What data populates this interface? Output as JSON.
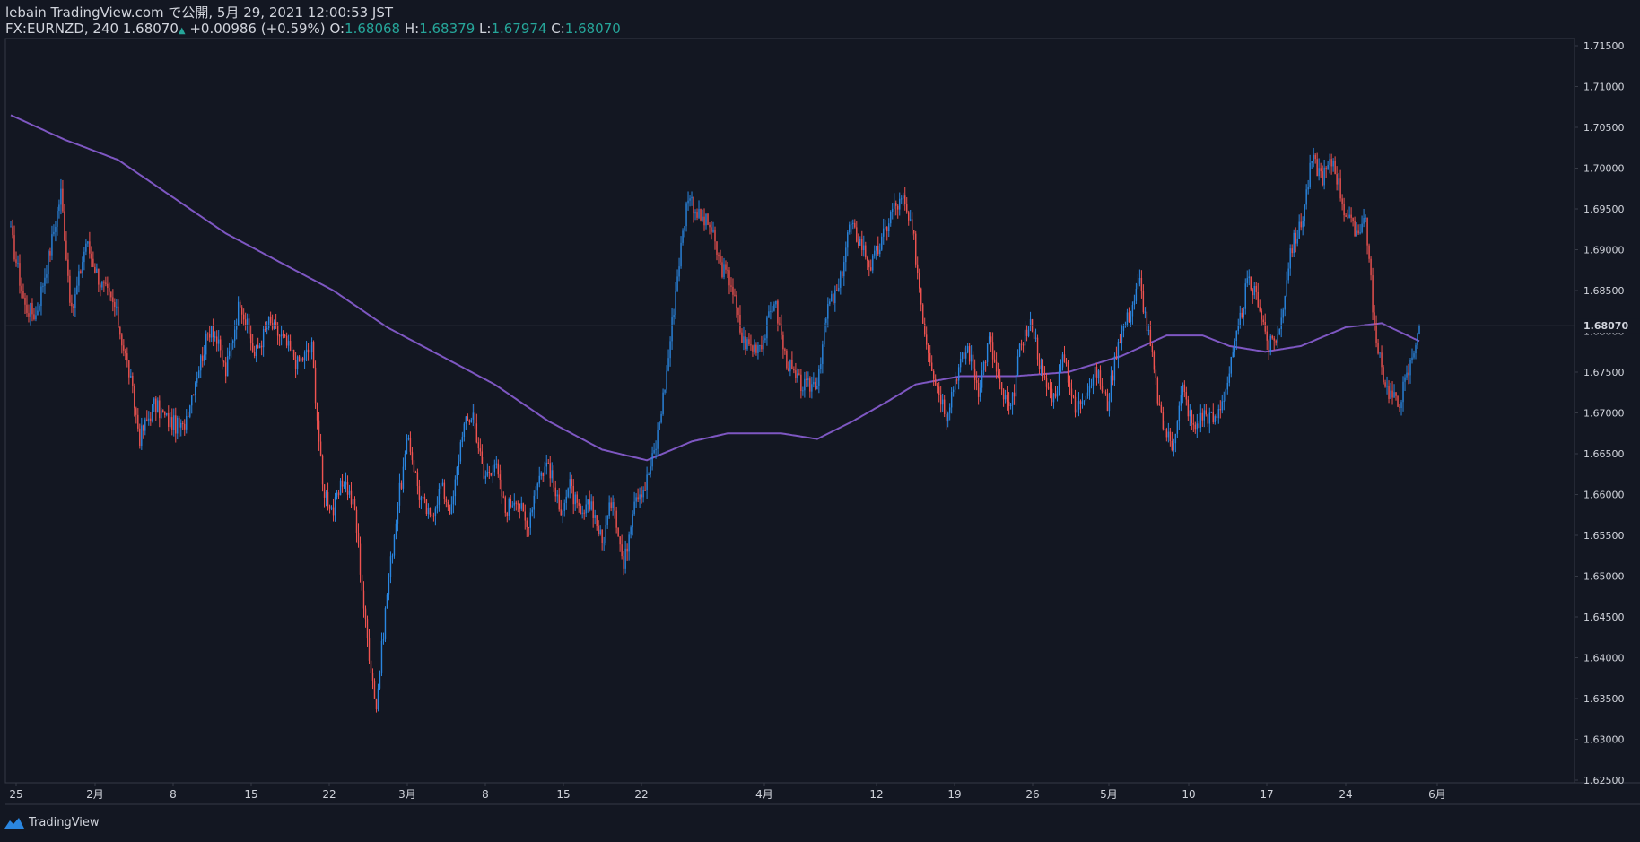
{
  "header": {
    "published": "lebain TradingView.com で公開, 5月 29, 2021 12:00:53 JST",
    "symbol": "FX:EURNZD, 240",
    "last": "1.68070",
    "change": "+0.00986 (+0.59%)",
    "o_label": "O:",
    "o": "1.68068",
    "h_label": "H:",
    "h": "1.68379",
    "l_label": "L:",
    "l": "1.67974",
    "c_label": "C:",
    "c": "1.68070"
  },
  "footer": {
    "brand": "TradingView",
    "logo_icon": "tradingview-logo-icon"
  },
  "colors": {
    "background": "#131722",
    "up": "#2a86e0",
    "down": "#ef5350",
    "ma": "#7e57c2",
    "axis_line": "#363a45",
    "text": "#d1d4dc"
  },
  "chart_data": {
    "type": "candlestick",
    "x_ticks": [
      "25",
      "2月",
      "8",
      "15",
      "22",
      "3月",
      "8",
      "15",
      "22",
      "4月",
      "12",
      "19",
      "26",
      "5月",
      "10",
      "17",
      "24",
      "6月"
    ],
    "y_ticks": [
      "1.71500",
      "1.71000",
      "1.70500",
      "1.70000",
      "1.69500",
      "1.69000",
      "1.68500",
      "1.68000",
      "1.67500",
      "1.67000",
      "1.66500",
      "1.66000",
      "1.65500",
      "1.65000",
      "1.64500",
      "1.64000",
      "1.63500",
      "1.63000",
      "1.62500"
    ],
    "ylim": [
      1.625,
      1.715
    ],
    "last_price_label": "1.68070",
    "last_price": 1.6807,
    "price_anchors": [
      [
        0,
        1.692
      ],
      [
        8,
        1.683
      ],
      [
        14,
        1.682
      ],
      [
        22,
        1.69
      ],
      [
        28,
        1.697
      ],
      [
        34,
        1.682
      ],
      [
        42,
        1.691
      ],
      [
        50,
        1.686
      ],
      [
        58,
        1.683
      ],
      [
        66,
        1.675
      ],
      [
        72,
        1.667
      ],
      [
        80,
        1.671
      ],
      [
        88,
        1.669
      ],
      [
        96,
        1.668
      ],
      [
        104,
        1.675
      ],
      [
        112,
        1.681
      ],
      [
        120,
        1.675
      ],
      [
        128,
        1.684
      ],
      [
        136,
        1.677
      ],
      [
        144,
        1.681
      ],
      [
        152,
        1.679
      ],
      [
        160,
        1.676
      ],
      [
        168,
        1.678
      ],
      [
        174,
        1.661
      ],
      [
        180,
        1.658
      ],
      [
        186,
        1.662
      ],
      [
        192,
        1.658
      ],
      [
        198,
        1.644
      ],
      [
        204,
        1.634
      ],
      [
        210,
        1.648
      ],
      [
        216,
        1.659
      ],
      [
        222,
        1.667
      ],
      [
        228,
        1.66
      ],
      [
        234,
        1.657
      ],
      [
        240,
        1.661
      ],
      [
        246,
        1.658
      ],
      [
        252,
        1.668
      ],
      [
        258,
        1.67
      ],
      [
        264,
        1.662
      ],
      [
        270,
        1.664
      ],
      [
        276,
        1.658
      ],
      [
        282,
        1.66
      ],
      [
        288,
        1.656
      ],
      [
        294,
        1.662
      ],
      [
        300,
        1.664
      ],
      [
        306,
        1.658
      ],
      [
        312,
        1.661
      ],
      [
        318,
        1.657
      ],
      [
        324,
        1.659
      ],
      [
        330,
        1.654
      ],
      [
        336,
        1.66
      ],
      [
        342,
        1.651
      ],
      [
        348,
        1.66
      ],
      [
        354,
        1.661
      ],
      [
        360,
        1.666
      ],
      [
        366,
        1.675
      ],
      [
        372,
        1.687
      ],
      [
        378,
        1.697
      ],
      [
        384,
        1.694
      ],
      [
        390,
        1.693
      ],
      [
        396,
        1.688
      ],
      [
        402,
        1.686
      ],
      [
        408,
        1.679
      ],
      [
        414,
        1.678
      ],
      [
        420,
        1.679
      ],
      [
        426,
        1.684
      ],
      [
        432,
        1.677
      ],
      [
        438,
        1.674
      ],
      [
        444,
        1.673
      ],
      [
        450,
        1.674
      ],
      [
        456,
        1.683
      ],
      [
        462,
        1.685
      ],
      [
        468,
        1.693
      ],
      [
        474,
        1.691
      ],
      [
        480,
        1.688
      ],
      [
        486,
        1.691
      ],
      [
        492,
        1.695
      ],
      [
        498,
        1.696
      ],
      [
        504,
        1.691
      ],
      [
        510,
        1.68
      ],
      [
        516,
        1.674
      ],
      [
        522,
        1.67
      ],
      [
        528,
        1.675
      ],
      [
        534,
        1.678
      ],
      [
        540,
        1.673
      ],
      [
        546,
        1.679
      ],
      [
        552,
        1.673
      ],
      [
        558,
        1.67
      ],
      [
        564,
        1.679
      ],
      [
        570,
        1.681
      ],
      [
        576,
        1.674
      ],
      [
        582,
        1.672
      ],
      [
        588,
        1.677
      ],
      [
        594,
        1.67
      ],
      [
        600,
        1.673
      ],
      [
        606,
        1.675
      ],
      [
        612,
        1.671
      ],
      [
        618,
        1.679
      ],
      [
        624,
        1.682
      ],
      [
        630,
        1.686
      ],
      [
        636,
        1.678
      ],
      [
        642,
        1.669
      ],
      [
        648,
        1.666
      ],
      [
        654,
        1.673
      ],
      [
        660,
        1.668
      ],
      [
        666,
        1.67
      ],
      [
        672,
        1.669
      ],
      [
        678,
        1.673
      ],
      [
        684,
        1.679
      ],
      [
        690,
        1.686
      ],
      [
        696,
        1.684
      ],
      [
        702,
        1.678
      ],
      [
        708,
        1.68
      ],
      [
        714,
        1.69
      ],
      [
        720,
        1.693
      ],
      [
        726,
        1.701
      ],
      [
        732,
        1.699
      ],
      [
        738,
        1.701
      ],
      [
        744,
        1.695
      ],
      [
        750,
        1.692
      ],
      [
        756,
        1.694
      ],
      [
        762,
        1.678
      ],
      [
        768,
        1.673
      ],
      [
        774,
        1.671
      ],
      [
        780,
        1.675
      ],
      [
        786,
        1.681
      ]
    ],
    "ma_anchors": [
      [
        0,
        1.7065
      ],
      [
        30,
        1.7035
      ],
      [
        60,
        1.701
      ],
      [
        90,
        1.6965
      ],
      [
        120,
        1.692
      ],
      [
        150,
        1.6885
      ],
      [
        180,
        1.685
      ],
      [
        210,
        1.6805
      ],
      [
        240,
        1.677
      ],
      [
        270,
        1.6735
      ],
      [
        300,
        1.669
      ],
      [
        330,
        1.6655
      ],
      [
        355,
        1.6642
      ],
      [
        380,
        1.6665
      ],
      [
        400,
        1.6675
      ],
      [
        430,
        1.6675
      ],
      [
        450,
        1.6668
      ],
      [
        470,
        1.669
      ],
      [
        490,
        1.6715
      ],
      [
        505,
        1.6735
      ],
      [
        530,
        1.6745
      ],
      [
        560,
        1.6745
      ],
      [
        590,
        1.675
      ],
      [
        620,
        1.677
      ],
      [
        645,
        1.6795
      ],
      [
        665,
        1.6795
      ],
      [
        680,
        1.6782
      ],
      [
        700,
        1.6775
      ],
      [
        720,
        1.6782
      ],
      [
        745,
        1.6805
      ],
      [
        765,
        1.681
      ],
      [
        786,
        1.6788
      ]
    ]
  }
}
